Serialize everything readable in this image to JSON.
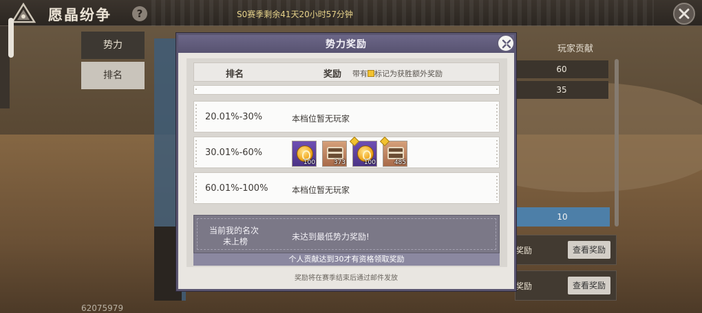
{
  "app": {
    "title": "愿晶纷争",
    "help_label": "?",
    "season_timer": "S0赛季剩余41天20小时57分钟",
    "player_id": "62075979"
  },
  "side_tabs": [
    {
      "label": "势力",
      "active": false
    },
    {
      "label": "排名",
      "active": true
    }
  ],
  "background_panel": {
    "column_header": "玩家贡献",
    "contributions": [
      "60",
      "35"
    ],
    "highlight_value": "10",
    "reward_rows": [
      {
        "label": "奖励",
        "button": "查看奖励"
      },
      {
        "label": "奖励",
        "button": "查看奖励"
      }
    ]
  },
  "modal": {
    "title": "势力奖励",
    "table_header": {
      "rank": "排名",
      "reward": "奖励",
      "note_prefix": "带有",
      "note_suffix": "标记为获胜额外奖励"
    },
    "tiers": [
      {
        "range": "20.01%-30%",
        "empty_text": "本档位暂无玩家",
        "items": []
      },
      {
        "range": "30.01%-60%",
        "empty_text": "",
        "items": [
          {
            "icon": "gold-coin-icon",
            "qty": "100",
            "bonus": false
          },
          {
            "icon": "treasure-chest-icon",
            "qty": "373",
            "bonus": false
          },
          {
            "icon": "gold-coin-icon",
            "qty": "100",
            "bonus": true
          },
          {
            "icon": "treasure-chest-icon",
            "qty": "485",
            "bonus": true
          }
        ]
      },
      {
        "range": "60.01%-100%",
        "empty_text": "本档位暂无玩家",
        "items": []
      }
    ],
    "my_rank": {
      "label": "当前我的名次",
      "value": "未上榜",
      "status": "未达到最低势力奖励!"
    },
    "requirement": "个人贡献达到30才有资格领取奖励",
    "footer": "奖励将在赛季结束后通过邮件发放"
  },
  "colors": {
    "modal_frame": "#5b5671",
    "accent_gold": "#f2c230",
    "highlight_blue": "#4d7fa8"
  }
}
